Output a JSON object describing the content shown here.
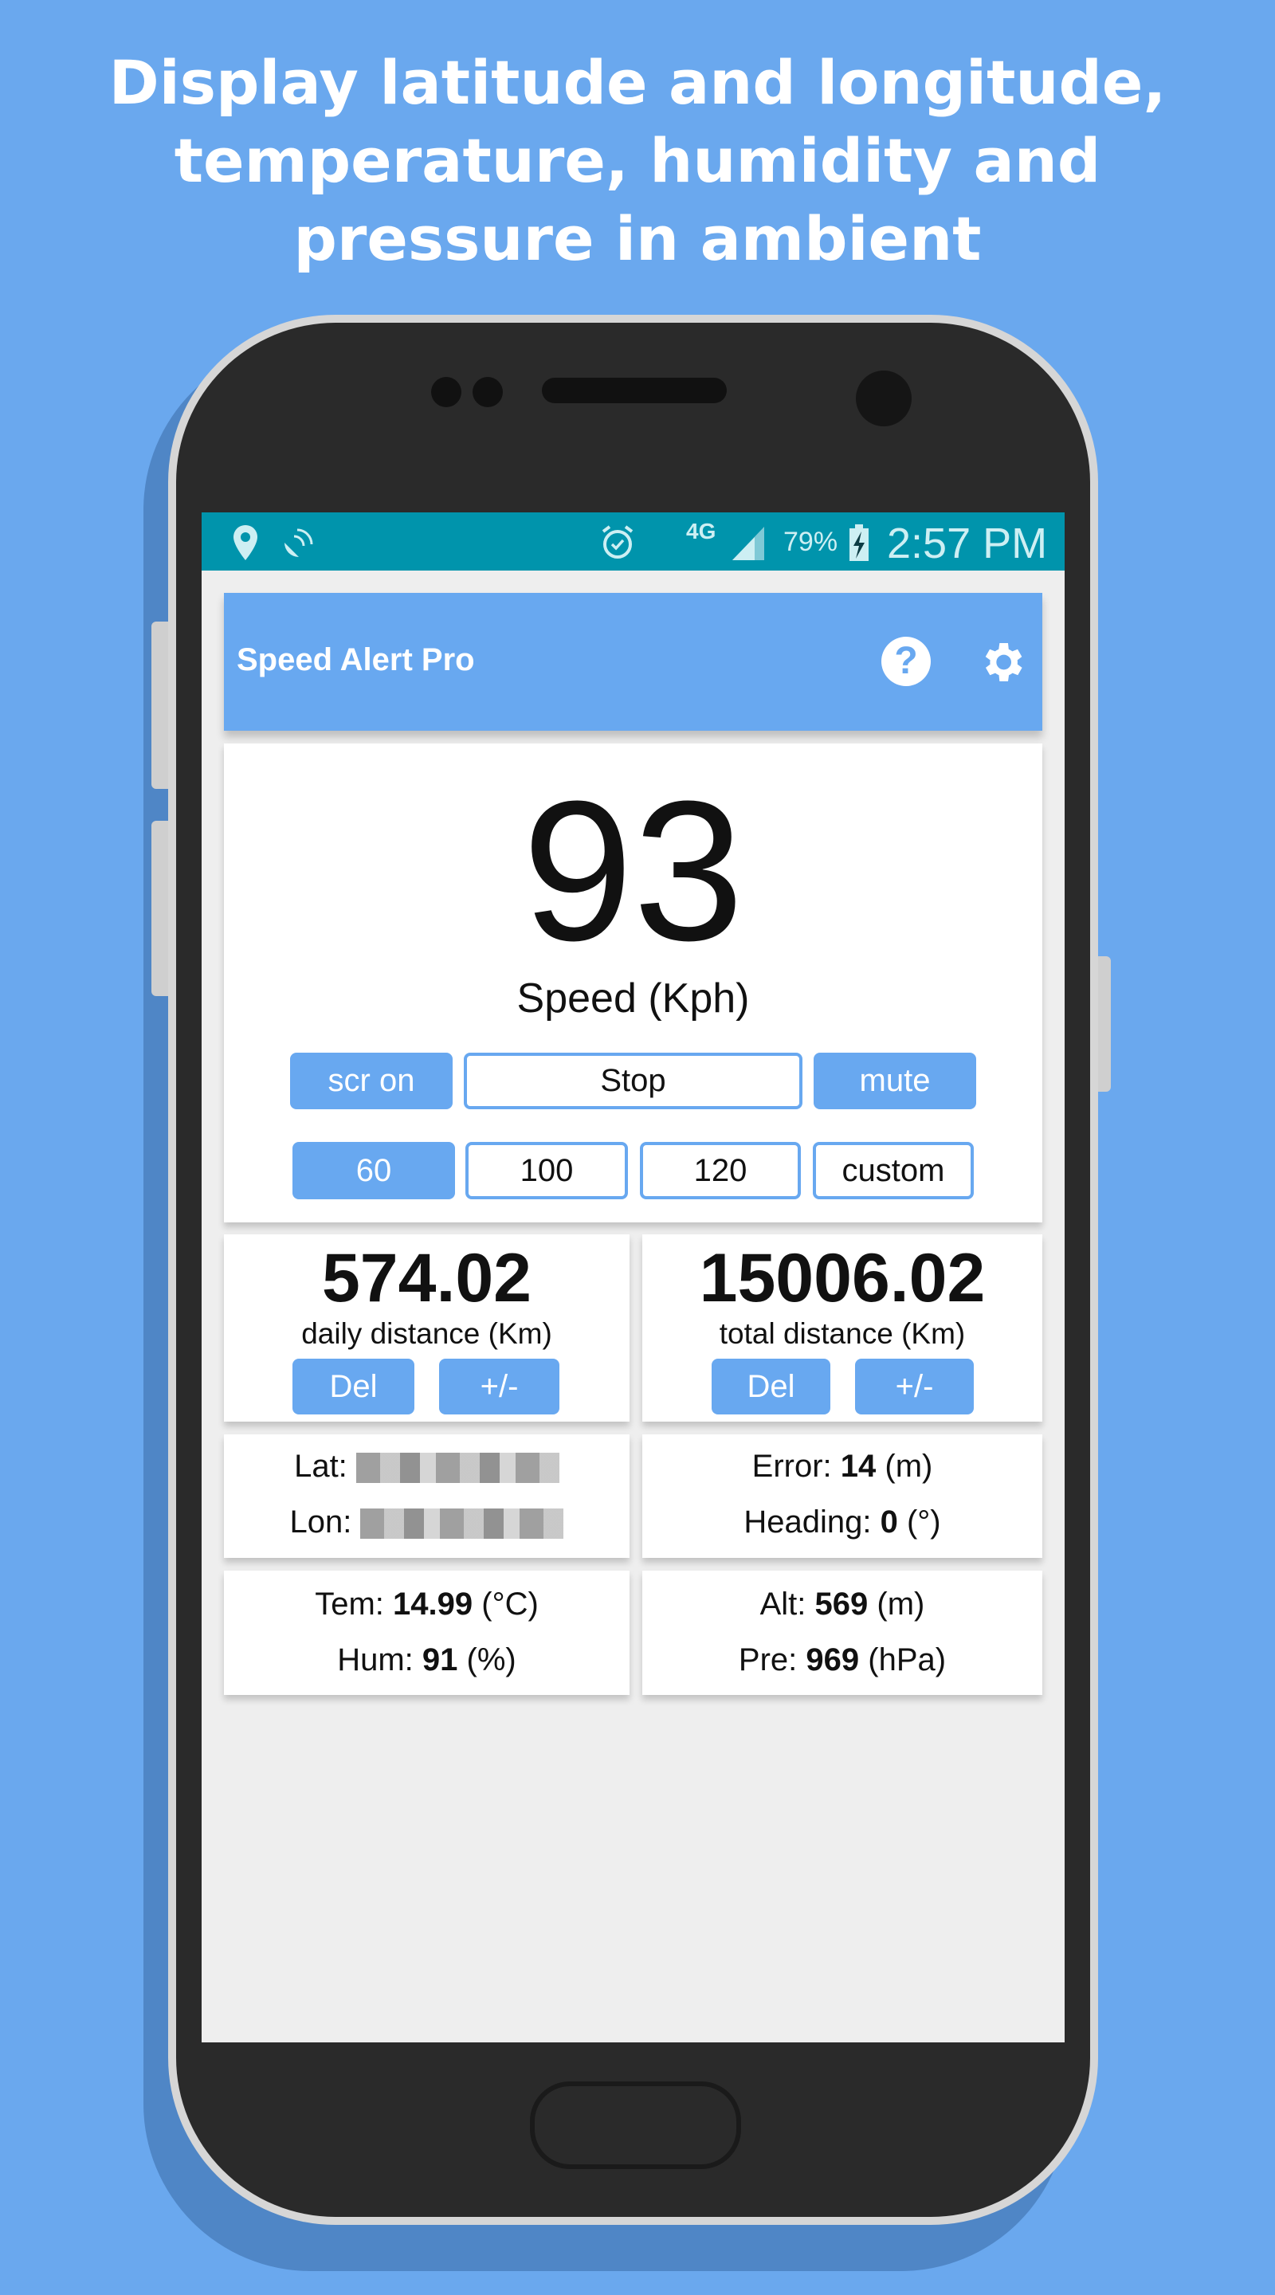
{
  "headline": [
    "Display latitude and longitude,",
    "temperature, humidity and",
    "pressure in ambient"
  ],
  "status_bar": {
    "network": "4G",
    "battery": "79%",
    "time": "2:57 PM",
    "icons": [
      "location-icon",
      "satellite-icon",
      "alarm-icon",
      "signal-icon",
      "battery-charging-icon"
    ],
    "color": "#0094AC"
  },
  "app_bar": {
    "title": "Speed Alert Pro",
    "icons": [
      "help-icon",
      "gear-icon"
    ],
    "color": "#68A8F0"
  },
  "speed": {
    "value": "93",
    "label": "Speed (Kph)"
  },
  "controls": {
    "row1": [
      "scr on",
      "Stop",
      "mute"
    ],
    "row2": [
      "60",
      "100",
      "120",
      "custom"
    ]
  },
  "daily": {
    "value": "574.02",
    "label": "daily distance (Km)",
    "del": "Del",
    "adjust": "+/-"
  },
  "total": {
    "value": "15006.02",
    "label": "total distance (Km)",
    "del": "Del",
    "adjust": "+/-"
  },
  "location": {
    "lat_label": "Lat:",
    "lon_label": "Lon:"
  },
  "accuracy": {
    "error_label": "Error:",
    "error_value": "14",
    "error_unit": "(m)",
    "heading_label": "Heading:",
    "heading_value": "0",
    "heading_unit": "(°)"
  },
  "ambient": {
    "tem_label": "Tem:",
    "tem_value": "14.99",
    "tem_unit": "(°C)",
    "hum_label": "Hum:",
    "hum_value": "91",
    "hum_unit": "(%)"
  },
  "altitude": {
    "alt_label": "Alt:",
    "alt_value": "569",
    "alt_unit": "(m)",
    "pre_label": "Pre:",
    "pre_value": "969",
    "pre_unit": "(hPa)"
  }
}
